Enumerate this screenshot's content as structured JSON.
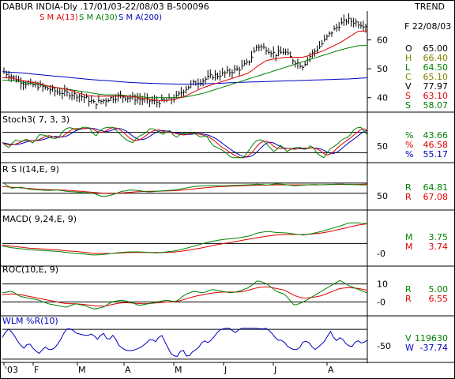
{
  "header": {
    "title": "DABUR INDIA-Dly .17/01/03-22/08/03  B-500096",
    "trend": "TREND",
    "date": "F 22/08/03"
  },
  "colors": {
    "black": "#000000",
    "red": "#e00000",
    "green": "#008000",
    "blue": "#0000c0"
  },
  "chart_data": [
    {
      "type": "line",
      "panel": "price",
      "series_labels": [
        {
          "name": "S M A(13)",
          "color": "#e00000"
        },
        {
          "name": "S M A(30)",
          "color": "#008000"
        },
        {
          "name": "S M A(200)",
          "color": "#0000c0"
        }
      ],
      "yticks": [
        40,
        50,
        60
      ],
      "ylim": [
        35,
        70
      ],
      "readout": [
        {
          "k": "O",
          "v": "65.00",
          "color": "#000000"
        },
        {
          "k": "H",
          "v": "66.40",
          "color": "#808000"
        },
        {
          "k": "L",
          "v": "64.50",
          "color": "#008000"
        },
        {
          "k": "C",
          "v": "65.10",
          "color": "#808000"
        },
        {
          "k": "V",
          "v": "77.97",
          "color": "#000000"
        },
        {
          "k": "S",
          "v": "63.10",
          "color": "#e00000"
        },
        {
          "k": "S",
          "v": "58.07",
          "color": "#008000"
        }
      ],
      "x_months": [
        "'03",
        "F",
        "M",
        "A",
        "M",
        "J",
        "J",
        "A"
      ],
      "close_series": [
        49,
        47,
        45.5,
        44.5,
        44,
        43,
        42,
        41.5,
        41,
        40,
        38,
        39,
        40,
        40.5,
        40,
        39.5,
        39,
        38.5,
        39,
        40,
        43,
        45,
        46,
        47.5,
        48,
        49,
        50,
        52,
        58,
        57,
        55,
        56,
        53,
        51,
        55,
        58,
        62,
        65,
        67,
        66,
        65
      ],
      "sma13": [
        47,
        46.8,
        46,
        45.5,
        45,
        44,
        43.5,
        43,
        42,
        41,
        40.5,
        40.5,
        40.5,
        40.5,
        40.5,
        40,
        39.5,
        39,
        39,
        39.5,
        40.5,
        42,
        43.5,
        44.5,
        45.5,
        46.5,
        47.5,
        48.5,
        51,
        53,
        53.5,
        54,
        54,
        54,
        55,
        56,
        57.5,
        59,
        61,
        63,
        63.1
      ],
      "sma30": [
        46,
        46,
        45.5,
        45,
        44.5,
        44,
        43.5,
        43,
        42.5,
        42,
        41.5,
        41,
        41,
        41,
        40.5,
        40.5,
        40,
        40,
        40,
        40,
        40.2,
        40.8,
        41.5,
        42.5,
        43.5,
        44.5,
        45.5,
        46.5,
        47.5,
        48.5,
        49.5,
        50.5,
        51.5,
        52.5,
        53.5,
        54.5,
        55.5,
        56.5,
        57.3,
        58,
        58.1
      ],
      "sma200": [
        49,
        48.8,
        48.6,
        48.3,
        48,
        47.7,
        47.4,
        47.1,
        46.8,
        46.5,
        46.2,
        46,
        45.8,
        45.5,
        45.3,
        45.1,
        45,
        44.9,
        44.8,
        44.7,
        44.7,
        44.7,
        44.8,
        44.9,
        45,
        45.2,
        45.3,
        45.4,
        45.5,
        45.6,
        45.7,
        45.8,
        45.9,
        46,
        46.1,
        46.2,
        46.3,
        46.4,
        46.5,
        46.7,
        46.9
      ]
    },
    {
      "type": "line",
      "panel": "stochastic",
      "label": "Stoch3( 7, 3, 3)",
      "ytick": "50",
      "ylim": [
        0,
        100
      ],
      "readout": [
        {
          "k": "%",
          "v": "43.66",
          "color": "#008000"
        },
        {
          "k": "%",
          "v": "46.58",
          "color": "#e00000"
        },
        {
          "k": "%",
          "v": "55.17",
          "color": "#0000c0"
        }
      ]
    },
    {
      "type": "line",
      "panel": "rsi",
      "label": "R S I(14,E, 9)",
      "ytick": "50",
      "ylim": [
        0,
        100
      ],
      "readout": [
        {
          "k": "R",
          "v": "64.81",
          "color": "#008000"
        },
        {
          "k": "R",
          "v": "67.08",
          "color": "#e00000"
        }
      ],
      "rsi": [
        72,
        55,
        58,
        52,
        50,
        48,
        50,
        46,
        44,
        42,
        40,
        30,
        35,
        45,
        50,
        48,
        44,
        46,
        48,
        50,
        55,
        60,
        62,
        63,
        62,
        63,
        64,
        65,
        67,
        64,
        68,
        66,
        62,
        64,
        66,
        65,
        66,
        67,
        66,
        65,
        64.8
      ],
      "signal": [
        60,
        58,
        56,
        54,
        52,
        51,
        50,
        49,
        47,
        45,
        43,
        40,
        39,
        41,
        43,
        45,
        46,
        46,
        47,
        48,
        50,
        53,
        56,
        58,
        60,
        61,
        62,
        63,
        64,
        64,
        65,
        65,
        65,
        65,
        65,
        65,
        66,
        66,
        66,
        66,
        67.1
      ]
    },
    {
      "type": "line",
      "panel": "macd",
      "label": "MACD( 9,24,E, 9)",
      "ytick": "-0",
      "ylim": [
        -4,
        5
      ],
      "readout": [
        {
          "k": "M",
          "v": "3.75",
          "color": "#008000"
        },
        {
          "k": "M",
          "v": "3.74",
          "color": "#e00000"
        }
      ],
      "macd": [
        -0.5,
        -0.8,
        -1.0,
        -1.2,
        -1.3,
        -1.4,
        -1.5,
        -1.7,
        -1.9,
        -2.0,
        -2.2,
        -2.1,
        -1.9,
        -1.7,
        -1.6,
        -1.6,
        -1.7,
        -1.8,
        -1.6,
        -1.4,
        -1.0,
        -0.5,
        0.0,
        0.4,
        0.7,
        0.9,
        1.1,
        1.4,
        2.0,
        2.3,
        2.1,
        2.0,
        1.8,
        1.6,
        1.9,
        2.3,
        2.8,
        3.3,
        3.9,
        3.9,
        3.75
      ],
      "signal": [
        -0.3,
        -0.5,
        -0.7,
        -0.9,
        -1.0,
        -1.1,
        -1.2,
        -1.4,
        -1.5,
        -1.7,
        -1.9,
        -1.9,
        -1.9,
        -1.8,
        -1.7,
        -1.7,
        -1.7,
        -1.7,
        -1.7,
        -1.6,
        -1.4,
        -1.1,
        -0.8,
        -0.4,
        -0.1,
        0.2,
        0.5,
        0.8,
        1.1,
        1.4,
        1.6,
        1.7,
        1.7,
        1.7,
        1.8,
        2.0,
        2.3,
        2.7,
        3.1,
        3.5,
        3.74
      ]
    },
    {
      "type": "line",
      "panel": "roc",
      "label": "ROC(10,E, 9)",
      "yticks": [
        "10",
        "-0"
      ],
      "ylim": [
        -6,
        16
      ],
      "readout": [
        {
          "k": "R",
          "v": "5.00",
          "color": "#008000"
        },
        {
          "k": "R",
          "v": "6.55",
          "color": "#e00000"
        }
      ],
      "roc": [
        5,
        6,
        3,
        2,
        1,
        -1,
        -2,
        -3,
        -1,
        -2,
        -4,
        -3,
        0,
        1,
        0,
        -2,
        -1,
        0,
        1,
        0,
        4,
        6,
        5,
        7,
        6,
        5,
        6,
        8,
        12,
        10,
        6,
        4,
        -2,
        0,
        3,
        6,
        9,
        12,
        9,
        7,
        5
      ],
      "signal": [
        4,
        4.5,
        4,
        3,
        2,
        1,
        0,
        -1,
        -1,
        -1.5,
        -2,
        -2.5,
        -1.5,
        -0.5,
        -0.5,
        -1,
        -1,
        -0.5,
        0,
        0,
        1.5,
        3,
        4,
        5,
        5.5,
        5.5,
        5.5,
        6.5,
        8,
        8.5,
        7.5,
        6.5,
        3.5,
        2,
        2.5,
        3.5,
        5.5,
        7.5,
        8,
        7.5,
        6.55
      ]
    },
    {
      "type": "line",
      "panel": "williams",
      "label": "WLM %R(10)",
      "ytick": "-50",
      "ylim": [
        -100,
        0
      ],
      "readout": [
        {
          "k": "V",
          "v": "119630",
          "color": "#008000"
        },
        {
          "k": "W",
          "v": "-37.74",
          "color": "#0000c0"
        }
      ]
    }
  ]
}
